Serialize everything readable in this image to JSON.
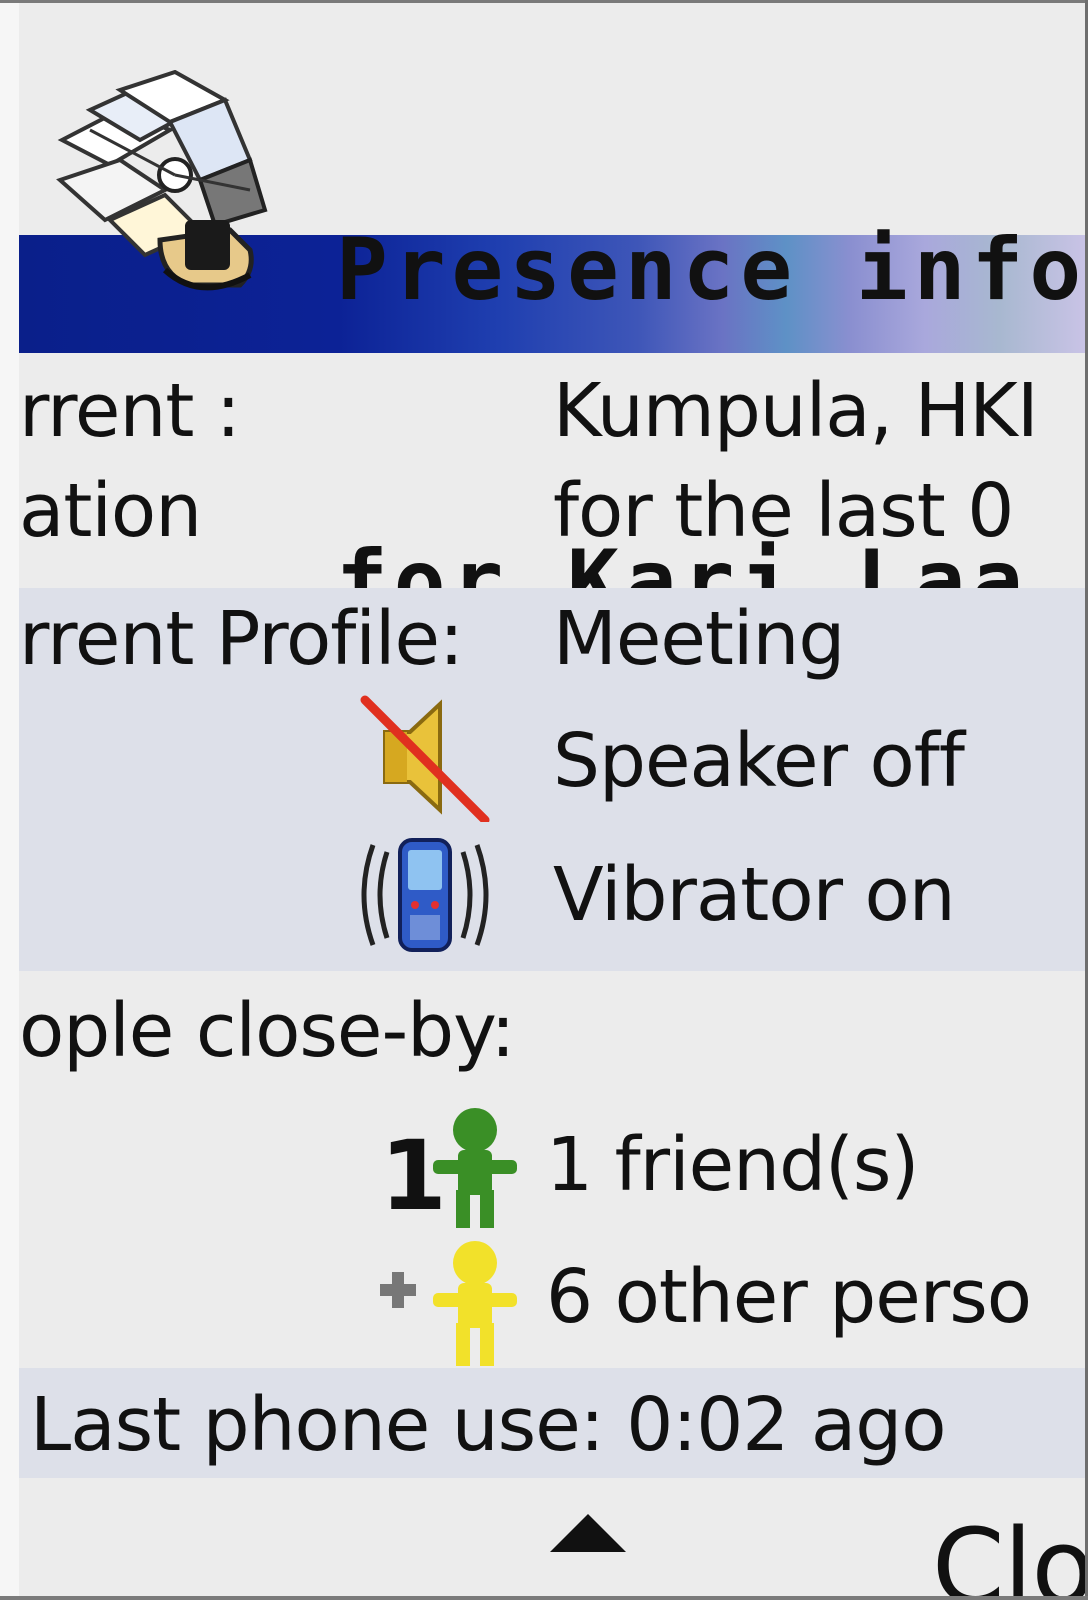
{
  "header": {
    "title_line1": "Presence info",
    "title_line2": "for  Kari Laa…",
    "logo_icon": "presence-logo-icon"
  },
  "location": {
    "label_line1": "rrent :",
    "label_line2": "ation",
    "value_line1": "Kumpula, HKI",
    "value_line2": "for the last 0"
  },
  "profile": {
    "label": "rrent Profile:",
    "name": "Meeting",
    "speaker_text": "Speaker off",
    "vibrator_text": "Vibrator on",
    "speaker_icon": "speaker-muted-icon",
    "vibrator_icon": "phone-vibrate-icon"
  },
  "people": {
    "label": "ople close-by:",
    "friends_badge": "1",
    "friends_text": "1 friend(s)",
    "others_text": "6 other perso",
    "friend_icon": "friend-person-icon",
    "other_icon": "other-person-icon"
  },
  "last_use": {
    "text": "Last phone use: 0:02 ago"
  },
  "softkeys": {
    "arrow_icon": "up-arrow-icon",
    "right_label": "Clo"
  },
  "colors": {
    "background": "#ececec",
    "highlight_row": "#dde0e9",
    "header_gradient_start": "#0a1f8a",
    "header_gradient_end": "#c9c3e6",
    "friend_green": "#3a8f26",
    "other_yellow": "#f2e12a"
  }
}
